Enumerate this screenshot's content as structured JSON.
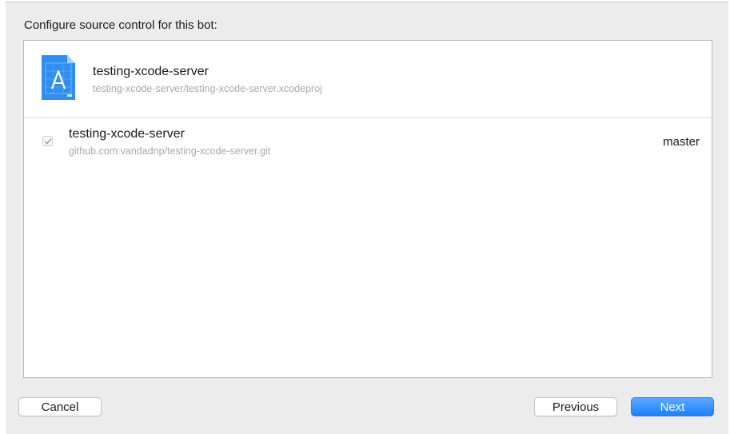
{
  "dialog": {
    "title": "Configure source control for this bot:"
  },
  "project": {
    "icon": "xcode-project-icon",
    "name": "testing-xcode-server",
    "path": "testing-xcode-server/testing-xcode-server.xcodeproj"
  },
  "repository": {
    "checked": true,
    "name": "testing-xcode-server",
    "url": "github.com:vandadnp/testing-xcode-server.git",
    "branch": "master"
  },
  "buttons": {
    "cancel": "Cancel",
    "previous": "Previous",
    "next": "Next"
  },
  "colors": {
    "accent": "#1a82fb",
    "secondary_text": "#a9a9a9"
  }
}
